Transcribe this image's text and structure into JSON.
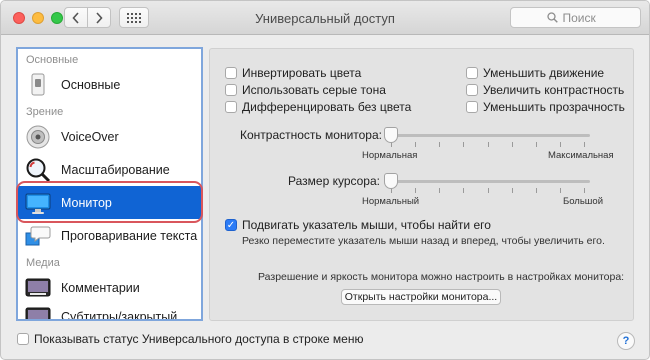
{
  "window": {
    "title": "Универсальный доступ"
  },
  "search": {
    "placeholder": "Поиск"
  },
  "sidebar": {
    "sections": {
      "main": "Основные",
      "vision": "Зрение",
      "media": "Медиа"
    },
    "items": {
      "general": "Основные",
      "voiceover": "VoiceOver",
      "zoom": "Масштабирование",
      "display": "Монитор",
      "speech": "Проговаривание текста",
      "captions": "Комментарии",
      "audio_desc": "Субтитры/закрытый текст"
    }
  },
  "options": {
    "invert": "Инвертировать цвета",
    "grayscale": "Использовать серые тона",
    "differentiate": "Дифференцировать без цвета",
    "reduce_motion": "Уменьшить движение",
    "increase_contrast": "Увеличить контрастность",
    "reduce_transparency": "Уменьшить прозрачность"
  },
  "contrast": {
    "label": "Контрастность монитора:",
    "min": "Нормальная",
    "max": "Максимальная",
    "value": 0
  },
  "cursor": {
    "label": "Размер курсора:",
    "min": "Нормальный",
    "max": "Большой",
    "value": 0
  },
  "shake": {
    "label": "Подвигать указатель мыши, чтобы найти его",
    "checked": true,
    "hint": "Резко переместите указатель мыши назад и вперед, чтобы увеличить его."
  },
  "display_settings": {
    "note": "Разрешение и яркость монитора можно настроить в настройках монитора:",
    "button": "Открыть настройки монитора..."
  },
  "bottom": {
    "menu_status": "Показывать статус Универсального доступа в строке меню",
    "help": "?"
  },
  "colors": {
    "selection": "#1064d4",
    "focus_ring": "#7fa6dc",
    "highlight_ring": "#d9565c",
    "checkbox": "#2d7cf6"
  }
}
